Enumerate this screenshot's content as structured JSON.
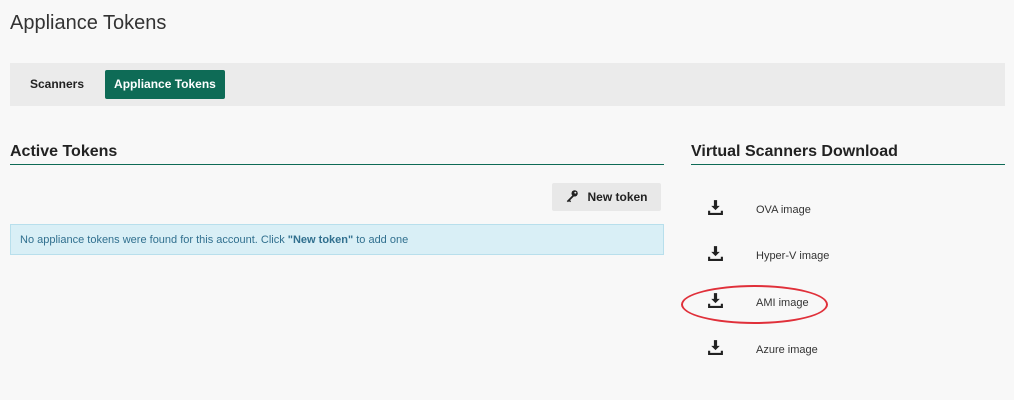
{
  "page": {
    "title": "Appliance Tokens"
  },
  "tabs": [
    {
      "label": "Scanners",
      "active": false
    },
    {
      "label": "Appliance Tokens",
      "active": true
    }
  ],
  "active_tokens": {
    "heading": "Active Tokens",
    "new_token_label": "New token",
    "new_token_icon": "key-icon",
    "empty_message_prefix": "No appliance tokens were found for this account. Click",
    "empty_message_link": "\"New token\"",
    "empty_message_suffix": "to add one"
  },
  "downloads": {
    "heading": "Virtual Scanners Download",
    "icon": "download-icon",
    "items": [
      {
        "label": "OVA image"
      },
      {
        "label": "Hyper-V image"
      },
      {
        "label": "AMI image"
      },
      {
        "label": "Azure image"
      }
    ]
  },
  "colors": {
    "accent": "#0e6b56",
    "alert_bg": "#d9eff6",
    "alert_text": "#31708f",
    "highlight": "#e0303a"
  }
}
